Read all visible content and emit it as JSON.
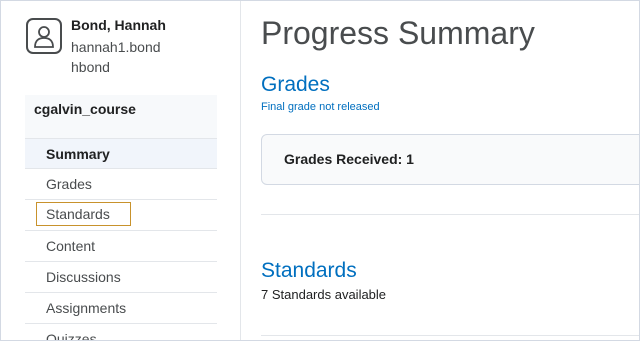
{
  "user": {
    "name": "Bond, Hannah",
    "username": "hannah1.bond",
    "org_id": "hbond"
  },
  "course": {
    "name": "cgalvin_course"
  },
  "nav": {
    "items": [
      {
        "label": "Summary"
      },
      {
        "label": "Grades"
      },
      {
        "label": "Standards"
      },
      {
        "label": "Content"
      },
      {
        "label": "Discussions"
      },
      {
        "label": "Assignments"
      },
      {
        "label": "Quizzes"
      }
    ]
  },
  "main": {
    "title": "Progress Summary",
    "grades": {
      "heading": "Grades",
      "note": "Final grade not released",
      "received": "Grades Received: 1"
    },
    "standards": {
      "heading": "Standards",
      "note": "7 Standards available"
    }
  },
  "colors": {
    "link": "#006fbf",
    "focus_outline": "#c8922c"
  },
  "icons": {
    "avatar": "user-silhouette-icon"
  }
}
